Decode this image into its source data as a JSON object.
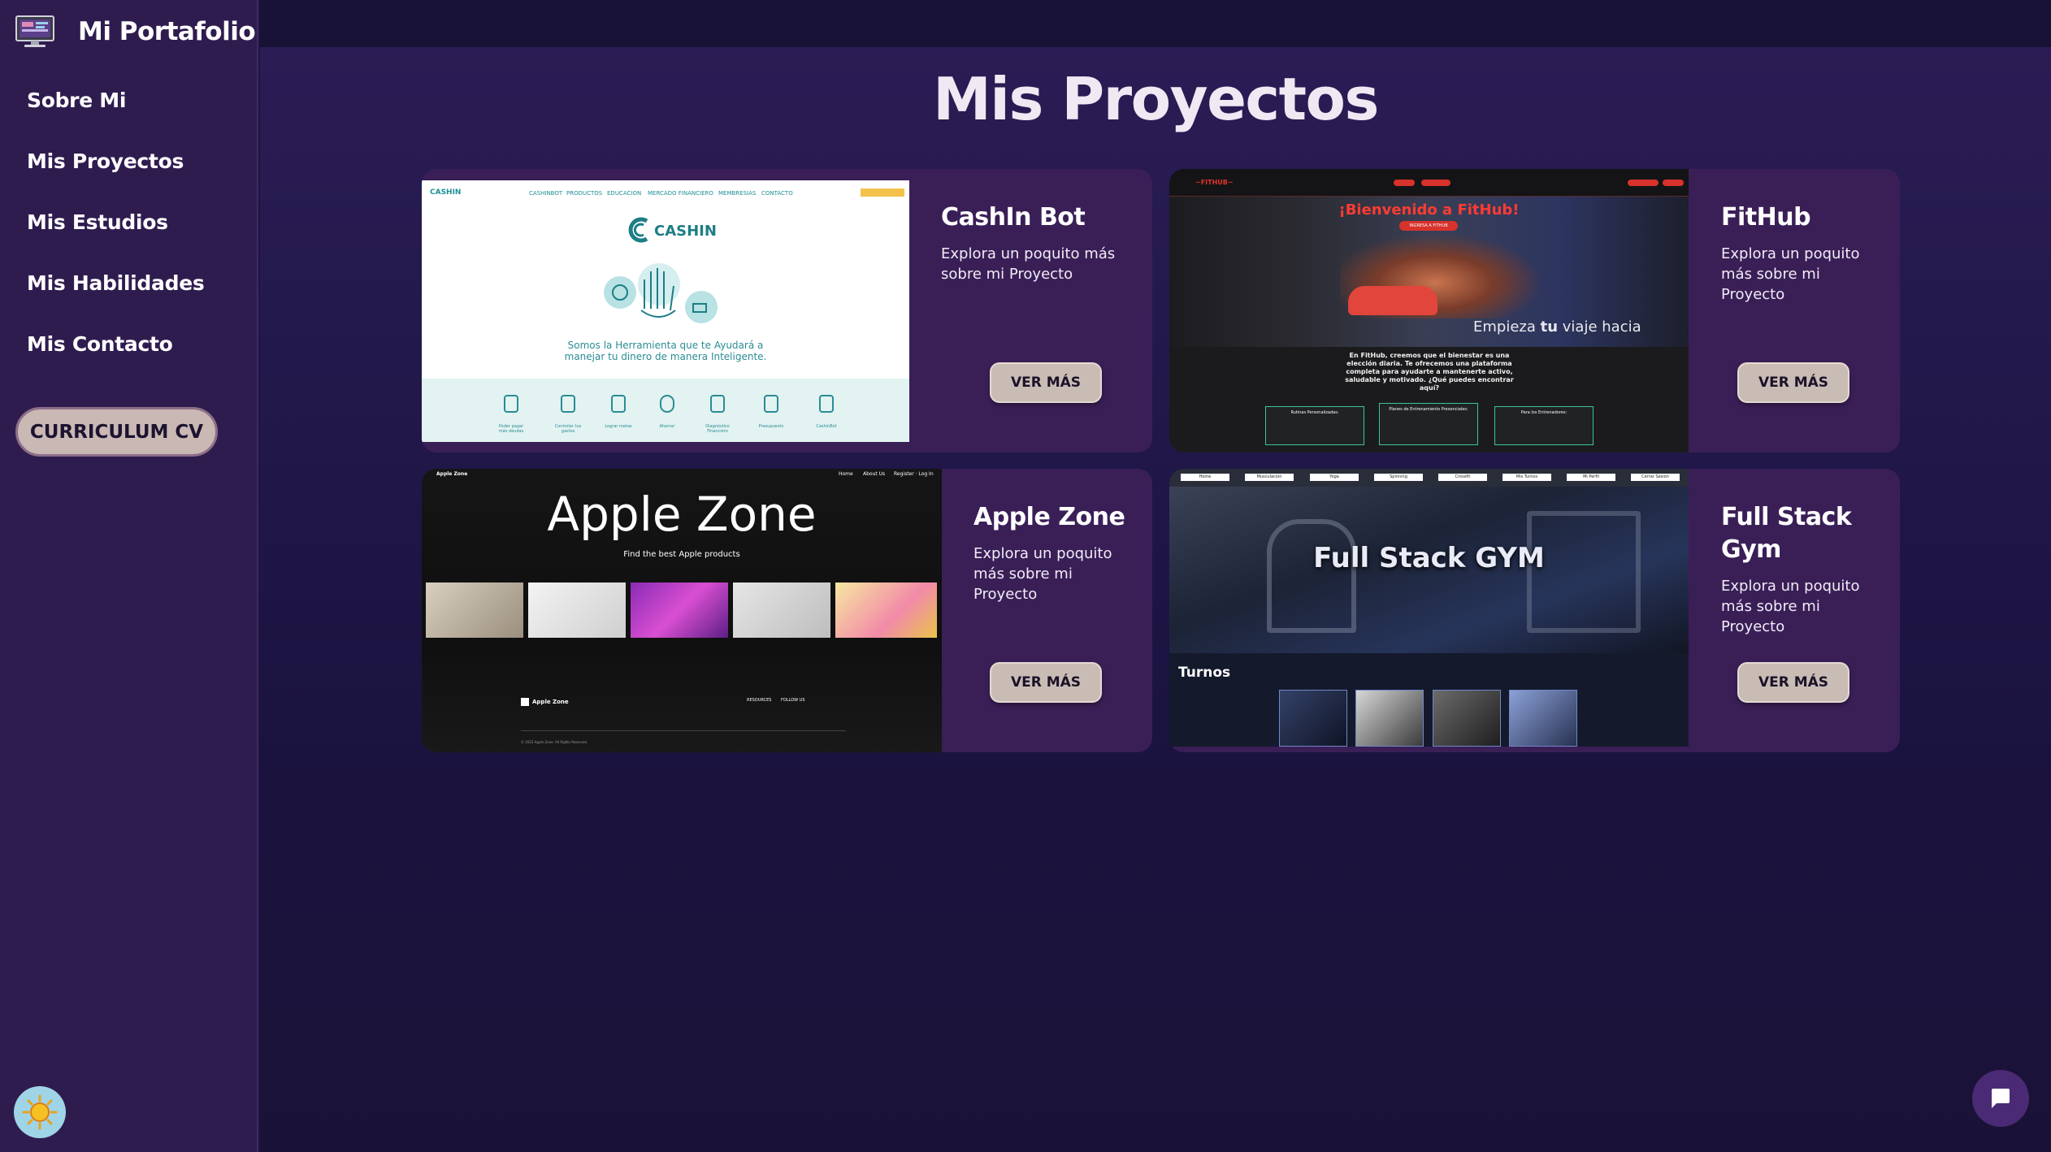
{
  "sidebar": {
    "brand": "Mi Portafolio",
    "nav": [
      "Sobre Mi",
      "Mis Proyectos",
      "Mis Estudios",
      "Mis Habilidades",
      "Mis Contacto"
    ],
    "cv_button": "CURRICULUM CV"
  },
  "main": {
    "title": "Mis Proyectos",
    "projects": [
      {
        "name": "CashIn Bot",
        "description": "Explora un poquito más sobre mi Proyecto",
        "button": "VER MÁS",
        "thumb": {
          "nav": [
            "CASHINBOT",
            "PRODUCTOS",
            "EDUCACION",
            "MERCADO FINANCIERO",
            "MEMBRESIAS",
            "CONTACTO"
          ],
          "logo": "CASHIN",
          "logo_small": "CASHIN",
          "tagline_1": "Somos la Herramienta que te Ayudará a",
          "tagline_2": "manejar tu dinero de manera Inteligente.",
          "features": [
            "Poder pagar más deudas",
            "Controlar tus gastos",
            "Lograr metas",
            "Ahorrar",
            "Diagnóstico Financiero",
            "Presupuesto",
            "CashinBot"
          ]
        }
      },
      {
        "name": "FitHub",
        "description": "Explora un poquito más sobre mi Proyecto",
        "button": "VER MÁS",
        "thumb": {
          "brand": "~FITHUB~",
          "welcome": "¡Bienvenido a FitHub!",
          "cta": "INGRESA A FITHUB",
          "overlay_1": "Empieza",
          "overlay_bold": "tu",
          "overlay_2": "viaje hacia",
          "paragraph": "En FitHub, creemos que el bienestar es una elección diaria. Te ofrecemos una plataforma completa para ayudarte a mantenerte activo, saludable y motivado. ¿Qué puedes encontrar aquí?",
          "boxes": [
            "Rutinas Personalizadas:",
            "Planes de Entrenamiento Presenciales:",
            "Para los Entrenadores:"
          ]
        }
      },
      {
        "name": "Apple Zone",
        "description": "Explora un poquito más sobre mi Proyecto",
        "button": "VER MÁS",
        "thumb": {
          "brand": "Apple Zone",
          "nav": [
            "Home",
            "About Us",
            "Register · Log In"
          ],
          "headline": "Apple Zone",
          "subhead": "Find the best Apple products",
          "footer_brand": "Apple Zone",
          "footer_cols": [
            "RESOURCES",
            "FOLLOW US"
          ],
          "copyright": "© 2023 Apple Zone. All Rights Reserved."
        }
      },
      {
        "name": "Full Stack Gym",
        "description": "Explora un poquito más sobre mi Proyecto",
        "button": "VER MÁS",
        "thumb": {
          "headline": "Full Stack GYM",
          "section": "Turnos",
          "nav": [
            "Home",
            "Musculacion",
            "Yoga",
            "Spinning",
            "Crossfit",
            "Mis Turnos",
            "Mi Perfil",
            "Cerrar Sesion"
          ]
        }
      }
    ]
  },
  "colors": {
    "sidebar_bg": "#2f1c4f",
    "main_bg": "#1e1541",
    "card_bg": "#3a1f57",
    "button_bg": "#c9bcb5"
  },
  "icons": [
    "monitor-icon",
    "sun-icon",
    "chat-icon"
  ]
}
